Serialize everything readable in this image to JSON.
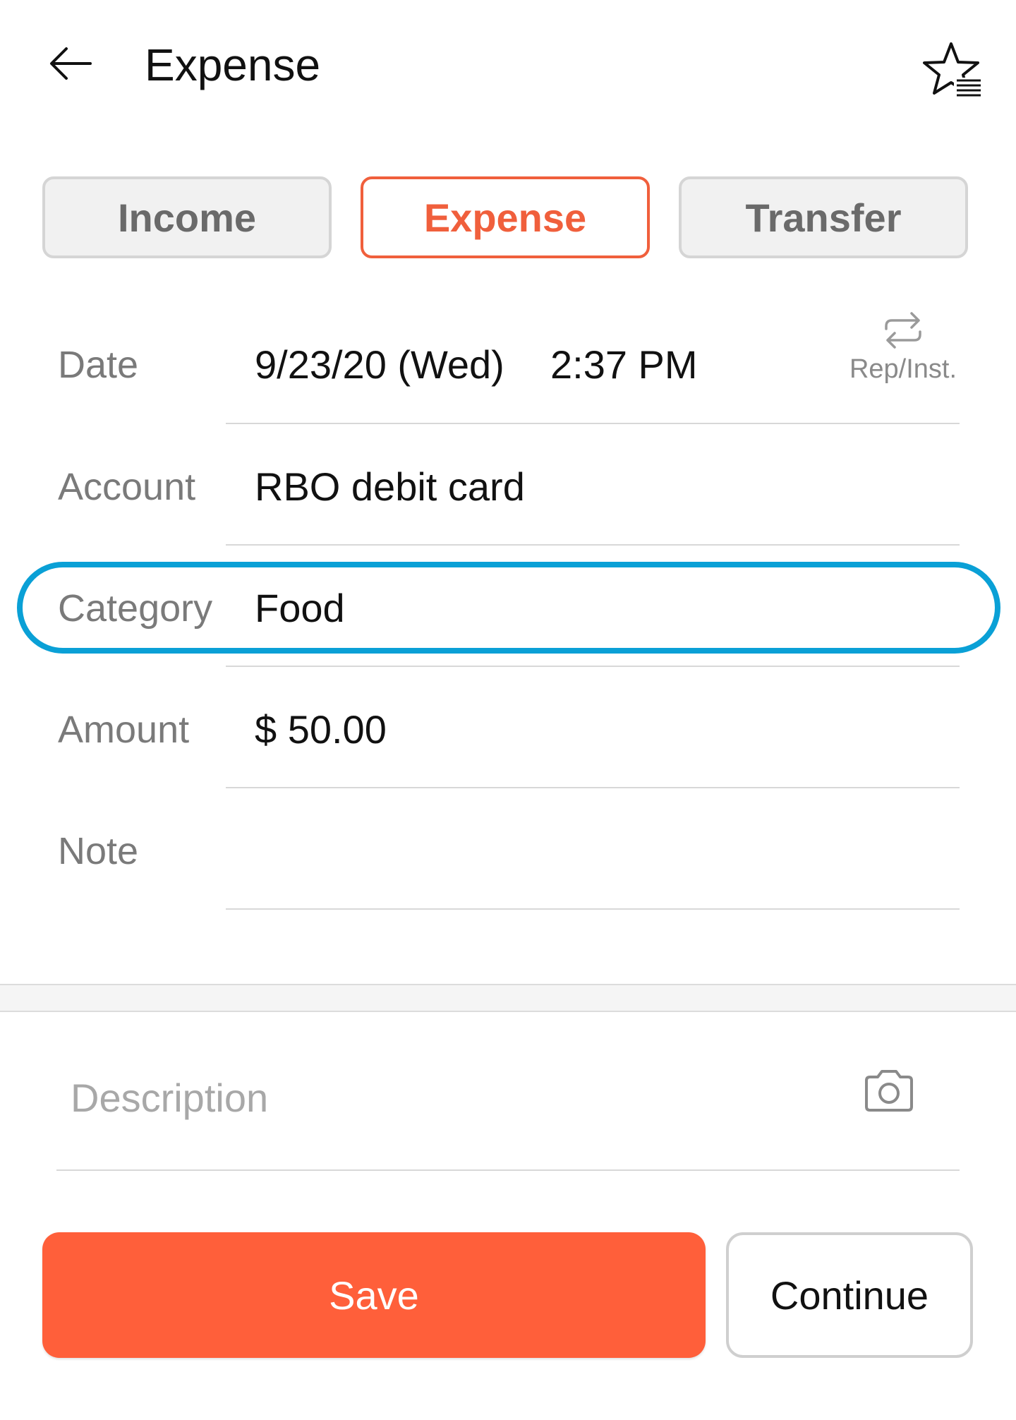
{
  "header": {
    "title": "Expense",
    "back_icon": "arrow-left-icon",
    "favorite_icon": "star-list-icon"
  },
  "tabs": [
    {
      "label": "Income",
      "active": false
    },
    {
      "label": "Expense",
      "active": true
    },
    {
      "label": "Transfer",
      "active": false
    }
  ],
  "form": {
    "date": {
      "label": "Date",
      "value": "9/23/20 (Wed)",
      "time": "2:37 PM"
    },
    "repeat": {
      "label": "Rep/Inst.",
      "icon": "repeat-icon"
    },
    "account": {
      "label": "Account",
      "value": "RBO debit card"
    },
    "category": {
      "label": "Category",
      "value": "Food"
    },
    "amount": {
      "label": "Amount",
      "value": "$ 50.00"
    },
    "note": {
      "label": "Note",
      "value": ""
    }
  },
  "description": {
    "placeholder": "Description",
    "value": "",
    "camera_icon": "camera-icon"
  },
  "actions": {
    "save_label": "Save",
    "continue_label": "Continue"
  },
  "colors": {
    "accent": "#ff5f3a",
    "active_tab": "#f05f3c",
    "highlight": "#0aa0d6"
  }
}
